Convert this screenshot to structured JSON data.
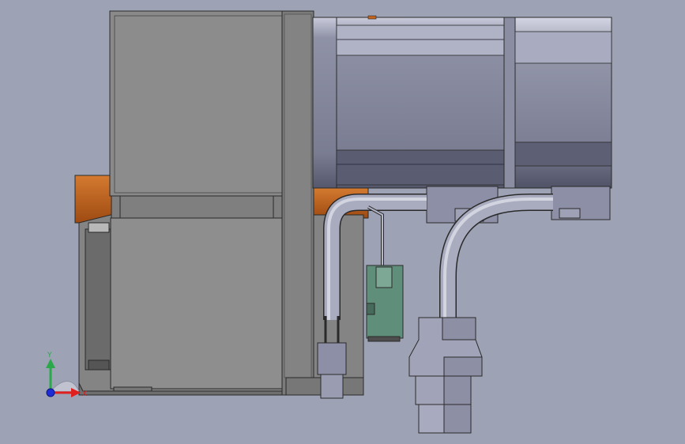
{
  "viewport": {
    "background": "#9da3b5"
  },
  "triad": {
    "x_label": "X",
    "y_label": "Y",
    "x_color": "#e02020",
    "y_color": "#2aa84a",
    "z_color": "#1e2cd6"
  },
  "colors": {
    "gearbox_body": "#8a8a8a",
    "gearbox_dark": "#6e6e6e",
    "motor_body": "#7c7f94",
    "motor_light": "#c4c6d6",
    "motor_dark": "#4c4e62",
    "flange_orange": "#c3641c",
    "cable": "#a6a8bc",
    "connector": "#8c8fa6",
    "connector_light": "#b4b6c8",
    "pcb_green": "#5f8f7a",
    "edge": "#2a2a2a"
  }
}
